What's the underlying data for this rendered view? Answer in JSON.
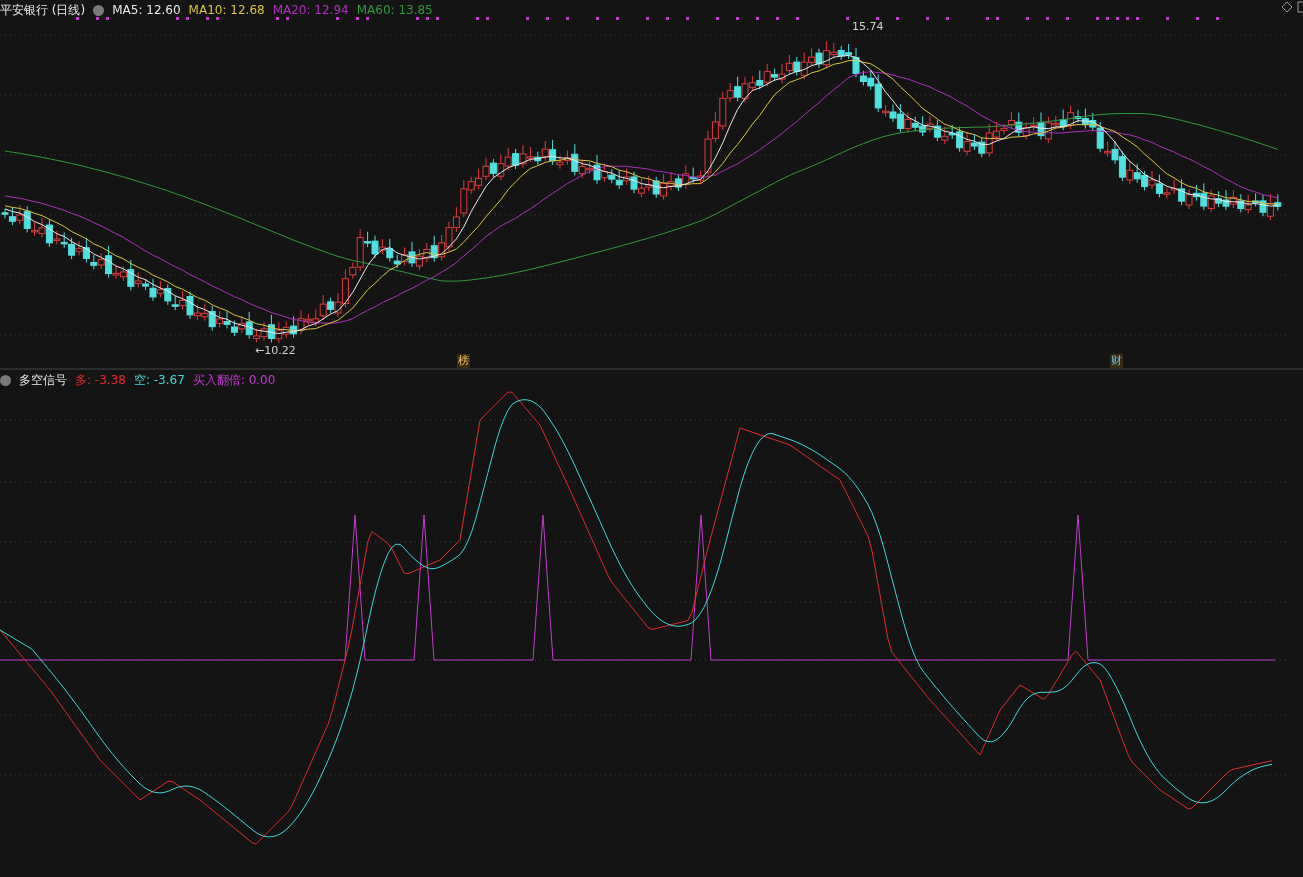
{
  "price_panel": {
    "title": "平安银行 (日线)",
    "ma_lines": [
      {
        "label": "MA5: 12.60",
        "color": "#e8e8e8"
      },
      {
        "label": "MA10: 12.68",
        "color": "#d8c441"
      },
      {
        "label": "MA20: 12.94",
        "color": "#b02fc0"
      },
      {
        "label": "MA60: 13.85",
        "color": "#2f9a3a"
      }
    ],
    "high_label": "15.74",
    "low_label": "←10.22",
    "event_tags": [
      "榜",
      "财"
    ]
  },
  "indicator_panel": {
    "title": "多空信号",
    "values": [
      {
        "label": "多: -3.38",
        "color": "#e02a2a"
      },
      {
        "label": "空: -3.67",
        "color": "#3ed6d6"
      },
      {
        "label": "买入翻倍: 0.00",
        "color": "#c43ad0"
      }
    ]
  }
}
